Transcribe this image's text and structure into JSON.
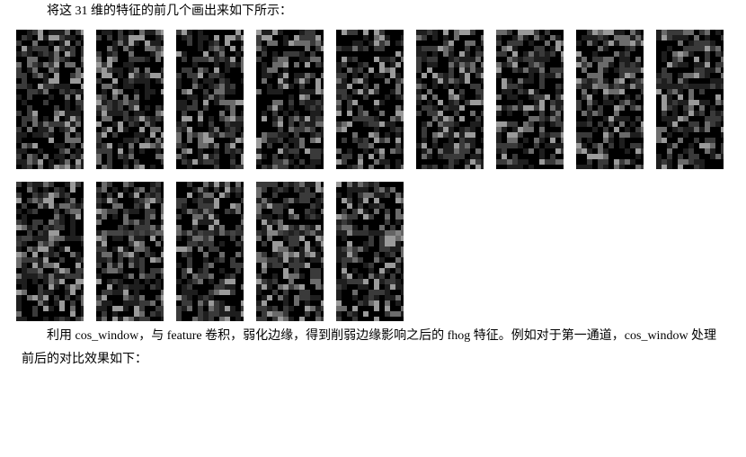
{
  "para1": "将这 31 维的特征的前几个画出来如下所示：",
  "para2": "利用 cos_window，与 feature 卷积，弱化边缘，得到削弱边缘影响之后的 fhog 特征。例如对于第一通道，cos_window 处理前后的对比效果如下：",
  "thumb_count": 14
}
